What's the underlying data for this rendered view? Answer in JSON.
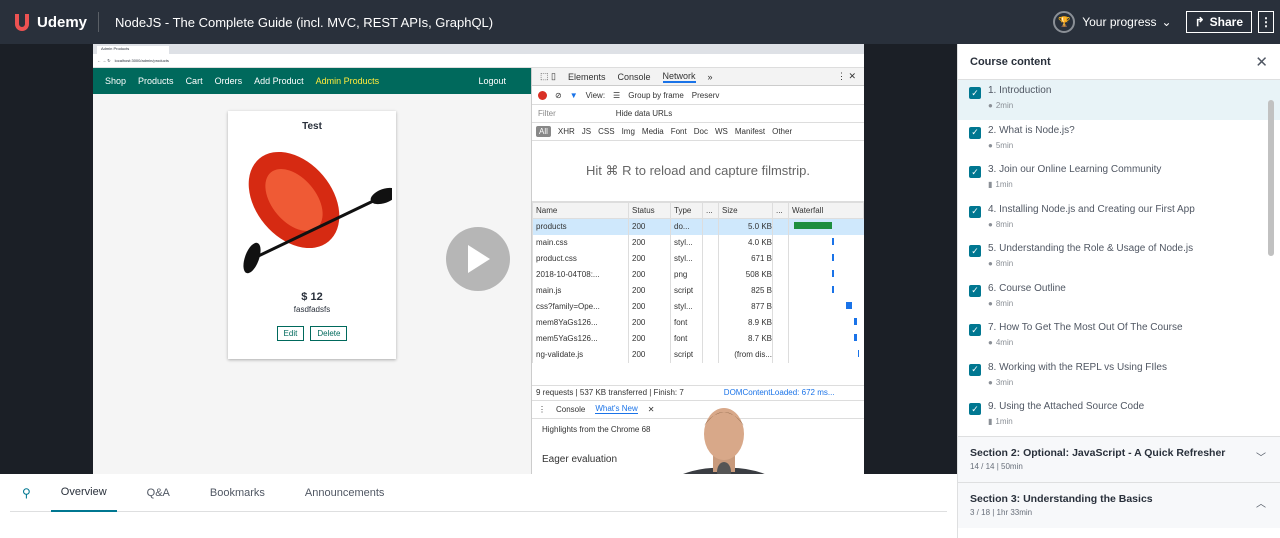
{
  "header": {
    "brand": "Udemy",
    "course_title": "NodeJS - The Complete Guide (incl. MVC, REST APIs, GraphQL)",
    "progress_label": "Your progress",
    "share_label": "Share"
  },
  "video": {
    "browser_tab": "Admin Products",
    "browser_url": "localhost:3000/admin/products",
    "app_nav": {
      "shop": "Shop",
      "products": "Products",
      "cart": "Cart",
      "orders": "Orders",
      "add_product": "Add Product",
      "admin_products": "Admin Products",
      "logout": "Logout"
    },
    "product": {
      "title": "Test",
      "price": "$ 12",
      "description": "fasdfadsfs",
      "edit_label": "Edit",
      "delete_label": "Delete"
    },
    "devtools": {
      "tabs": [
        "Elements",
        "Console",
        "Network"
      ],
      "view_label": "View:",
      "group_by_frame": "Group by frame",
      "preserve": "Preserv",
      "filter_placeholder": "Filter",
      "hide_data_urls": "Hide data URLs",
      "types": [
        "All",
        "XHR",
        "JS",
        "CSS",
        "Img",
        "Media",
        "Font",
        "Doc",
        "WS",
        "Manifest",
        "Other"
      ],
      "filmstrip_hint": "Hit ⌘ R to reload and capture filmstrip.",
      "columns": {
        "name": "Name",
        "status": "Status",
        "type": "Type",
        "dots": "...",
        "size": "Size",
        "waterfall": "Waterfall"
      },
      "rows": [
        {
          "name": "products",
          "status": "200",
          "type": "do...",
          "size": "5.0 KB"
        },
        {
          "name": "main.css",
          "status": "200",
          "type": "styl...",
          "size": "4.0 KB"
        },
        {
          "name": "product.css",
          "status": "200",
          "type": "styl...",
          "size": "671 B"
        },
        {
          "name": "2018-10-04T08:...",
          "status": "200",
          "type": "png",
          "size": "508 KB"
        },
        {
          "name": "main.js",
          "status": "200",
          "type": "script",
          "size": "825 B"
        },
        {
          "name": "css?family=Ope...",
          "status": "200",
          "type": "styl...",
          "size": "877 B"
        },
        {
          "name": "mem8YaGs126...",
          "status": "200",
          "type": "font",
          "size": "8.9 KB"
        },
        {
          "name": "mem5YaGs126...",
          "status": "200",
          "type": "font",
          "size": "8.7 KB"
        },
        {
          "name": "ng-validate.js",
          "status": "200",
          "type": "script",
          "size": "(from dis..."
        }
      ],
      "status_bar": "9 requests | 537 KB transferred | Finish: 7",
      "status_bar_end": "DOMContentLoaded: 672 ms...",
      "drawer_tabs": [
        "Console",
        "What's New"
      ],
      "drawer_highlight": "Highlights from the Chrome 68",
      "eager": "Eager evaluation"
    }
  },
  "tabs": [
    "Overview",
    "Q&A",
    "Bookmarks",
    "Announcements"
  ],
  "sidebar": {
    "title": "Course content",
    "lectures": [
      {
        "title": "1. Introduction",
        "meta": "2min",
        "kind": "video"
      },
      {
        "title": "2. What is Node.js?",
        "meta": "5min",
        "kind": "video"
      },
      {
        "title": "3. Join our Online Learning Community",
        "meta": "1min",
        "kind": "doc"
      },
      {
        "title": "4. Installing Node.js and Creating our First App",
        "meta": "8min",
        "kind": "video"
      },
      {
        "title": "5. Understanding the Role & Usage of Node.js",
        "meta": "8min",
        "kind": "video"
      },
      {
        "title": "6. Course Outline",
        "meta": "8min",
        "kind": "video"
      },
      {
        "title": "7. How To Get The Most Out Of The Course",
        "meta": "4min",
        "kind": "video"
      },
      {
        "title": "8. Working with the REPL vs Using FIles",
        "meta": "3min",
        "kind": "video"
      },
      {
        "title": "9. Using the Attached Source Code",
        "meta": "1min",
        "kind": "doc"
      }
    ],
    "sections": [
      {
        "title": "Section 2: Optional: JavaScript - A Quick Refresher",
        "meta": "14 / 14 | 50min",
        "chevron": "down"
      },
      {
        "title": "Section 3: Understanding the Basics",
        "meta": "3 / 18 | 1hr 33min",
        "chevron": "up"
      }
    ]
  },
  "colors": {
    "topbar": "#29303b",
    "accent": "#007791",
    "app_nav": "#00695c"
  }
}
